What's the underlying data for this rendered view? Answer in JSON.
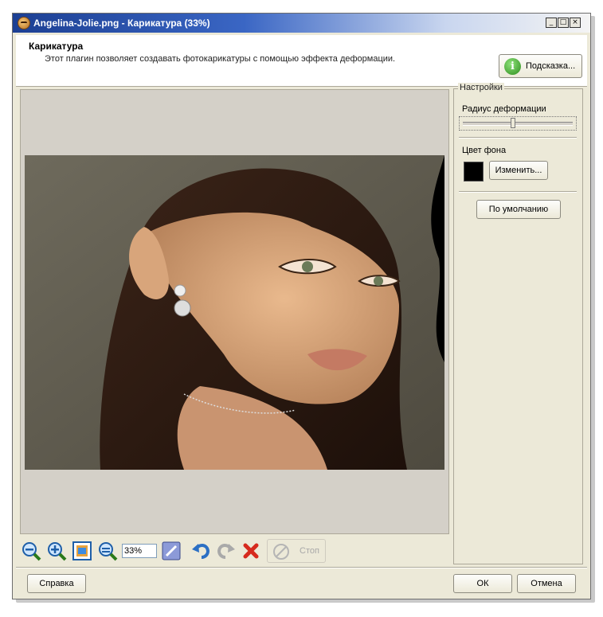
{
  "window": {
    "title": "Angelina-Jolie.png - Карикатура (33%)",
    "controls": {
      "minimize": "_",
      "maximize": "□",
      "close": "×"
    }
  },
  "header": {
    "title": "Карикатура",
    "description": "Этот плагин позволяет создавать фотокарикатуры с помощью эффекта деформации.",
    "hint_button": "Подсказка...",
    "hint_icon": "i"
  },
  "settings": {
    "group_title": "Настройки",
    "radius_label": "Радиус деформации",
    "radius_value": 0.45,
    "bg_color_label": "Цвет фона",
    "bg_color": "#000000",
    "change_button": "Изменить...",
    "default_button": "По умолчанию"
  },
  "toolbar": {
    "zoom_value": "33%",
    "stop_button": "Стоп",
    "icons": [
      "zoom-out-icon",
      "zoom-in-icon",
      "fit-to-window-icon",
      "actual-size-icon",
      "apply-icon",
      "undo-icon",
      "redo-icon",
      "delete-icon",
      "stop-icon"
    ]
  },
  "footer": {
    "help_button": "Справка",
    "ok_button": "ОК",
    "cancel_button": "Отмена"
  },
  "colors": {
    "titlebar_start": "#1c3f93",
    "window_bg": "#ece9d8",
    "canvas_bg": "#d4d0c8",
    "hint_green": "#2c8c1c"
  }
}
